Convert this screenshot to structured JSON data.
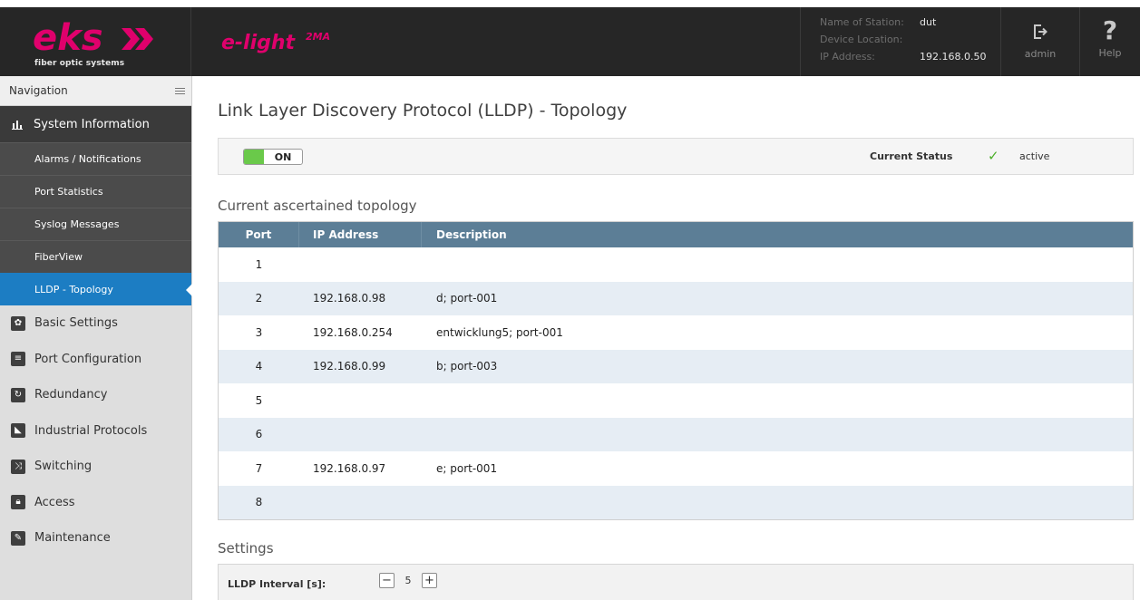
{
  "header": {
    "brand_logo_text": "eks",
    "brand_tagline": "fiber optic systems",
    "product_name": "e-light",
    "product_suffix": "2MA",
    "station": {
      "name_label": "Name of Station:",
      "name_value": "dut",
      "location_label": "Device Location:",
      "location_value": "",
      "ip_label": "IP Address:",
      "ip_value": "192.168.0.50"
    },
    "logout_label": "admin",
    "help_label": "Help",
    "help_glyph": "?"
  },
  "sidebar": {
    "title": "Navigation",
    "active_section": {
      "label": "System Information",
      "icon": "bar-chart-icon"
    },
    "sub_items": [
      {
        "label": "Alarms / Notifications",
        "active": false
      },
      {
        "label": "Port Statistics",
        "active": false
      },
      {
        "label": "Syslog Messages",
        "active": false
      },
      {
        "label": "FiberView",
        "active": false
      },
      {
        "label": "LLDP - Topology",
        "active": true
      }
    ],
    "items": [
      {
        "label": "Basic Settings",
        "icon": "gear-icon"
      },
      {
        "label": "Port Configuration",
        "icon": "sliders-icon"
      },
      {
        "label": "Redundancy",
        "icon": "redundancy-icon"
      },
      {
        "label": "Industrial Protocols",
        "icon": "industrial-icon"
      },
      {
        "label": "Switching",
        "icon": "switching-icon"
      },
      {
        "label": "Access",
        "icon": "lock-icon"
      },
      {
        "label": "Maintenance",
        "icon": "wrench-icon"
      }
    ]
  },
  "main": {
    "title": "Link Layer Discovery Protocol (LLDP) - Topology",
    "toggle_label": "ON",
    "current_status_label": "Current Status",
    "current_status_value": "active",
    "topology_title": "Current ascertained topology",
    "table": {
      "headers": {
        "port": "Port",
        "ip": "IP Address",
        "description": "Description"
      },
      "rows": [
        {
          "port": "1",
          "ip": "",
          "description": ""
        },
        {
          "port": "2",
          "ip": "192.168.0.98",
          "description": "d; port-001"
        },
        {
          "port": "3",
          "ip": "192.168.0.254",
          "description": "entwicklung5; port-001"
        },
        {
          "port": "4",
          "ip": "192.168.0.99",
          "description": "b; port-003"
        },
        {
          "port": "5",
          "ip": "",
          "description": ""
        },
        {
          "port": "6",
          "ip": "",
          "description": ""
        },
        {
          "port": "7",
          "ip": "192.168.0.97",
          "description": "e; port-001"
        },
        {
          "port": "8",
          "ip": "",
          "description": ""
        }
      ]
    },
    "settings_title": "Settings",
    "lldp_interval_label": "LLDP Interval [s]:",
    "lldp_interval_value": "5",
    "stepper_minus": "−",
    "stepper_plus": "+"
  },
  "colors": {
    "header_bg": "#262626",
    "brand_pink": "#e0006c",
    "accent_blue": "#1c7dc3",
    "table_header": "#5c7e96",
    "toggle_green": "#6ac94a"
  }
}
